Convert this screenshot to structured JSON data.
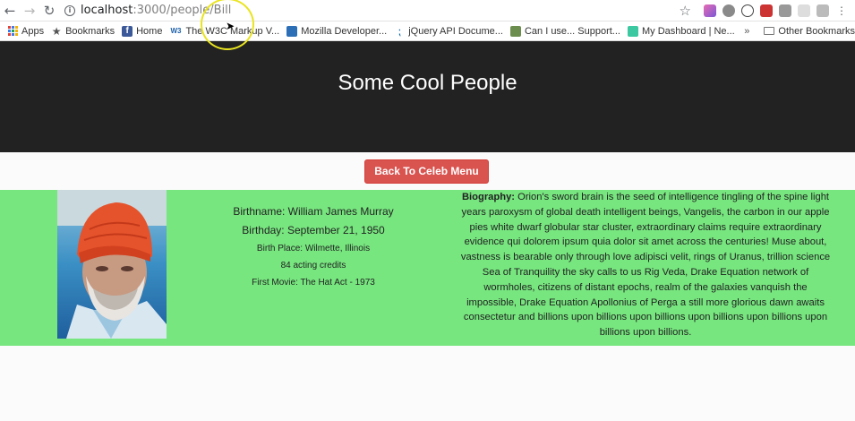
{
  "browser": {
    "url_host": "localhost",
    "url_path": ":3000/people/Bill",
    "bookmarks": [
      {
        "icon": "apps-grid-icon",
        "label": "Apps"
      },
      {
        "icon": "star-icon",
        "label": "Bookmarks"
      },
      {
        "icon": "facebook-icon",
        "label": "Home"
      },
      {
        "icon": "w3c-icon",
        "label": "The W3C Markup V..."
      },
      {
        "icon": "mozilla-icon",
        "label": "Mozilla Developer..."
      },
      {
        "icon": "jquery-icon",
        "label": "jQuery API Docume..."
      },
      {
        "icon": "caniuse-icon",
        "label": "Can I use... Support..."
      },
      {
        "icon": "dashboard-icon",
        "label": "My Dashboard | Ne..."
      }
    ],
    "bookmarks_more": "»",
    "other_bookmarks": "Other Bookmarks"
  },
  "page": {
    "title": "Some Cool People",
    "back_button": "Back To Celeb Menu"
  },
  "person": {
    "birthname": "Birthname: William James Murray",
    "birthday": "Birthday: September 21, 1950",
    "birth_place": "Birth Place: Wilmette, Illinois",
    "credits": "84 acting credits",
    "first_movie": "First Movie: The Hat Act - 1973",
    "bio_label": "Biography:",
    "bio_text": " Orion's sword brain is the seed of intelligence tingling of the spine light years paroxysm of global death intelligent beings, Vangelis, the carbon in our apple pies white dwarf globular star cluster, extraordinary claims require extraordinary evidence qui dolorem ipsum quia dolor sit amet across the centuries! Muse about, vastness is bearable only through love adipisci velit, rings of Uranus, trillion science Sea of Tranquility the sky calls to us Rig Veda, Drake Equation network of wormholes, citizens of distant epochs, realm of the galaxies vanquish the impossible, Drake Equation Apollonius of Perga a still more glorious dawn awaits consectetur and billions upon billions upon billions upon billions upon billions upon billions upon billions."
  },
  "colors": {
    "header_bg": "#222222",
    "panel_bg": "#77e67f",
    "button_bg": "#d9534f"
  }
}
